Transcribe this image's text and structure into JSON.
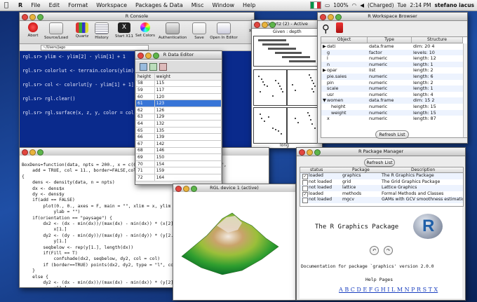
{
  "menubar": {
    "app": "R",
    "items": [
      "File",
      "Edit",
      "Format",
      "Workspace",
      "Packages & Data",
      "Misc",
      "Window",
      "Help"
    ],
    "battery": "100%",
    "charged": "(Charged)",
    "day": "Tue",
    "time": "2:14 PM",
    "user": "stefano iacus"
  },
  "console": {
    "title": "R Console",
    "toolbar": [
      "Abort",
      "Source/Load",
      "Quartz",
      "History",
      "Start X11",
      "Set Colors",
      "Authentication",
      "Save",
      "Open In Editor"
    ],
    "path": "~/Users/jago",
    "lines": [
      "rgl.sr> ylim <- ylim[2] - ylim[1] + 1",
      "rgl.sr> colorlut <- terrain.colors(ylim)",
      "rgl.sr> col <- colorlut[y - ylim[1] + 1]",
      "rgl.sr> rgl.clear()",
      "rgl.sr> rgl.surface(x, z, y, color = col)"
    ]
  },
  "dataeditor": {
    "title": "R Data Editor",
    "columns": [
      "height",
      "weight"
    ],
    "rows": [
      [
        "58",
        "115"
      ],
      [
        "59",
        "117"
      ],
      [
        "60",
        "120"
      ],
      [
        "61",
        "123"
      ],
      [
        "62",
        "126"
      ],
      [
        "63",
        "129"
      ],
      [
        "64",
        "132"
      ],
      [
        "65",
        "135"
      ],
      [
        "66",
        "139"
      ],
      [
        "67",
        "142"
      ],
      [
        "68",
        "146"
      ],
      [
        "69",
        "150"
      ],
      [
        "70",
        "154"
      ],
      [
        "71",
        "159"
      ],
      [
        "72",
        "164"
      ]
    ],
    "selected_row": 3
  },
  "quartz": {
    "title": "Quartz (2) - Active",
    "given_label": "Given : depth",
    "xlabel": "long"
  },
  "workspace": {
    "title": "R Workspace Browser",
    "columns": [
      "Object",
      "Type",
      "Structure"
    ],
    "rows": [
      {
        "object": "dati",
        "type": "data.frame",
        "structure": "dim: 20 4",
        "expander": "▶"
      },
      {
        "object": "g",
        "type": "factor",
        "structure": "levels: 10",
        "expander": ""
      },
      {
        "object": "l",
        "type": "numeric",
        "structure": "length: 12",
        "expander": ""
      },
      {
        "object": "n",
        "type": "numeric",
        "structure": "length: 1",
        "expander": ""
      },
      {
        "object": "opar",
        "type": "list",
        "structure": "length: 2",
        "expander": "▶"
      },
      {
        "object": "pie.sales",
        "type": "numeric",
        "structure": "length: 6",
        "expander": ""
      },
      {
        "object": "pin",
        "type": "numeric",
        "structure": "length: 2",
        "expander": ""
      },
      {
        "object": "scale",
        "type": "numeric",
        "structure": "length: 1",
        "expander": ""
      },
      {
        "object": "usr",
        "type": "numeric",
        "structure": "length: 4",
        "expander": ""
      },
      {
        "object": "women",
        "type": "data.frame",
        "structure": "dim: 15 2",
        "expander": "▼"
      },
      {
        "object": "height",
        "type": "numeric",
        "structure": "length: 15",
        "expander": ""
      },
      {
        "object": "weight",
        "type": "numeric",
        "structure": "length: 15",
        "expander": ""
      },
      {
        "object": "x",
        "type": "numeric",
        "structure": "length: 87",
        "expander": ""
      }
    ],
    "refresh": "Refresh List"
  },
  "editor": {
    "lines": [
      "BoxDens=function(data, npts = 200., x = c(0.5, 1.5), orientation = \"paysage\",",
      "    add = TRUE, col = 11., border=FALSE,colin",
      "{",
      "    dens <- density(data, n = npts)",
      "    dx <- dens$x",
      "    dy <- dens$y",
      "    if(add == FALSE)",
      "        plot(0., 0., axes = F, main = \"\", xlim = x, ylim = y, x",
      "            ylab = \"\")",
      "    if(orientation == \"paysage\") {",
      "        dx2 <- (dx - min(dx))/(max(dx) - min(dx)) * (x[2] - x",
      "            x[1.]",
      "        dy2 <- (dy - min(dy))/(max(dy) - min(dy)) * (y[2.] - y",
      "            y[1.]",
      "        seqbelow <- rep(y[1.], length(dx))",
      "        if(Fill == T)",
      "            confshade(dx2, seqbelow, dy2, col = col)",
      "        if (border==TRUE) points(dx2, dy2, type = \"l\", col = c",
      "    }",
      "    else {",
      "        dy2 <- (dx - min(dx))/(max(dx) - min(dx)) * (y[2] - y",
      "            y[1.]"
    ]
  },
  "rgl": {
    "title": "RGL device 1 (active)"
  },
  "pkgmgr": {
    "title": "R Package Manager",
    "refresh": "Refresh List",
    "columns": [
      "status",
      "Package",
      "Description"
    ],
    "rows": [
      {
        "status": "loaded",
        "checked": true,
        "package": "graphics",
        "description": "The R Graphics Package"
      },
      {
        "status": "not loaded",
        "checked": false,
        "package": "grid",
        "description": "The Grid Graphics Package"
      },
      {
        "status": "not loaded",
        "checked": false,
        "package": "lattice",
        "description": "Lattice Graphics"
      },
      {
        "status": "loaded",
        "checked": true,
        "package": "methods",
        "description": "Formal Methods and Classes"
      },
      {
        "status": "not loaded",
        "checked": false,
        "package": "mgcv",
        "description": "GAMs with GCV smoothness estimation"
      }
    ],
    "doc_heading": "The R Graphics Package",
    "doc_text": "Documentation for package `graphics' version 2.0.0",
    "help_pages": "Help Pages",
    "alphabet": "A B C D E F G H I L M N P R S T X"
  },
  "colors": {
    "console_bg": "#0a2a8c",
    "accent": "#2a63d6",
    "select": "#3875d7"
  }
}
